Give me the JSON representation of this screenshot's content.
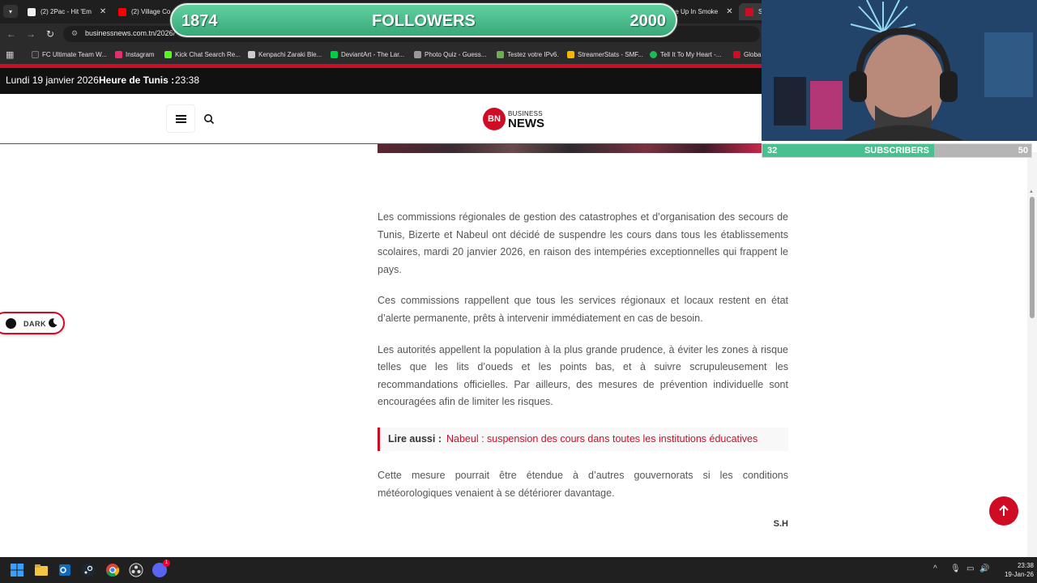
{
  "browser": {
    "tabs": [
      {
        "title": "(2) 2Pac - Hit 'Em",
        "fav_color": "#eeeeee"
      },
      {
        "title": "(2) Village Cool",
        "fav_color": "#ff0000"
      },
      {
        "title": "The Up In Smoke",
        "fav_color": "#ff0000"
      },
      {
        "title": "Se",
        "fav_color": "#d00c24"
      }
    ],
    "url": "businessnews.com.tn/2026/",
    "bookmarks": [
      {
        "label": "FC Ultimate Team W...",
        "fav_color": "#333333"
      },
      {
        "label": "Instagram",
        "fav_color": "#e1306c"
      },
      {
        "label": "Kick Chat Search Re...",
        "fav_color": "#53fc18"
      },
      {
        "label": "Kenpachi Zaraki Ble...",
        "fav_color": "#cccccc"
      },
      {
        "label": "DeviantArt - The Lar...",
        "fav_color": "#05cc47"
      },
      {
        "label": "Photo Quiz - Guess...",
        "fav_color": "#999999"
      },
      {
        "label": "Testez votre IPv6.",
        "fav_color": "#6ab04c"
      },
      {
        "label": "StreamerStats - SMF...",
        "fav_color": "#f5b700"
      },
      {
        "label": "Tell It To My Heart -...",
        "fav_color": "#1db954"
      },
      {
        "label": "Globa",
        "fav_color": "#d00c24"
      }
    ]
  },
  "overlay": {
    "followers_current": "1874",
    "followers_label": "FOLLOWERS",
    "followers_goal": "2000",
    "subs_current": "32",
    "subs_label": "SUBSCRIBERS",
    "subs_goal": "50",
    "subs_progress": 0.64
  },
  "site": {
    "date": "Lundi 19 janvier 2026",
    "time_label": "Heure de Tunis :",
    "time": "23:38",
    "logo_bn": "BN",
    "logo_business": "BUSINESS",
    "logo_news": "NEWS",
    "dark_label": "DARK"
  },
  "article": {
    "paragraphs": [
      "Les commissions régionales de gestion des catastrophes et d’organisation des secours de Tunis, Bizerte et Nabeul ont décidé de suspendre les cours dans tous les établissements scolaires, mardi 20 janvier 2026, en raison des intempéries exceptionnelles qui frappent le pays.",
      "Ces commissions rappellent que tous les services régionaux et locaux restent en état d’alerte permanente, prêts à intervenir immédiatement en cas de besoin.",
      "Les autorités appellent la population à la plus grande prudence, à éviter les zones à risque telles que les lits d’oueds et les points bas, et à suivre scrupuleusement les recommandations officielles. Par ailleurs, des mesures de prévention individuelle sont encouragées afin de limiter les risques."
    ],
    "read_also_label": "Lire aussi :",
    "read_also_link": "Nabeul : suspension des cours dans toutes les institutions éducatives",
    "closing": "Cette mesure pourrait être étendue à d’autres gouvernorats si les conditions météorologiques venaient à se détériorer davantage.",
    "signature": "S.H"
  },
  "taskbar": {
    "clock_time": "23:38",
    "clock_date": "19-Jan-26",
    "discord_badge": "1"
  },
  "colors": {
    "brand_red": "#d00c24",
    "overlay_green": "#49c08f"
  }
}
